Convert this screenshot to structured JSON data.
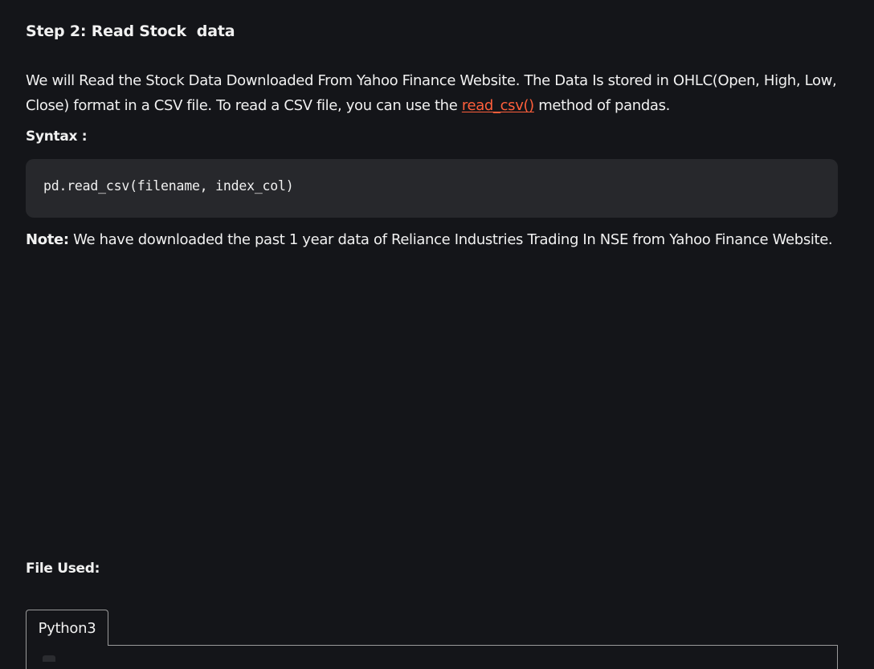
{
  "step_heading": "Step 2: Read Stock  data",
  "intro": {
    "text_before_link": "We will Read the Stock Data Downloaded From Yahoo Finance Website. The Data Is stored in OHLC(Open, High, Low, Close)  format in a CSV file. To read a CSV file, you can use the ",
    "link_text": "read_csv()",
    "text_after_link": " method of pandas.",
    "link_color": "#ff5f3b"
  },
  "syntax_label": "Syntax :",
  "code": "pd.read_csv(filename, index_col)",
  "note": {
    "label": "Note:",
    "text": " We have downloaded the past 1 year data of Reliance Industries Trading In NSE from Yahoo Finance Website."
  },
  "file_used_label": "File Used:",
  "tabs": [
    {
      "label": "Python3",
      "active": true
    }
  ],
  "colors": {
    "background": "#141519",
    "code_background": "#27282c",
    "text": "#f1f1f1"
  }
}
